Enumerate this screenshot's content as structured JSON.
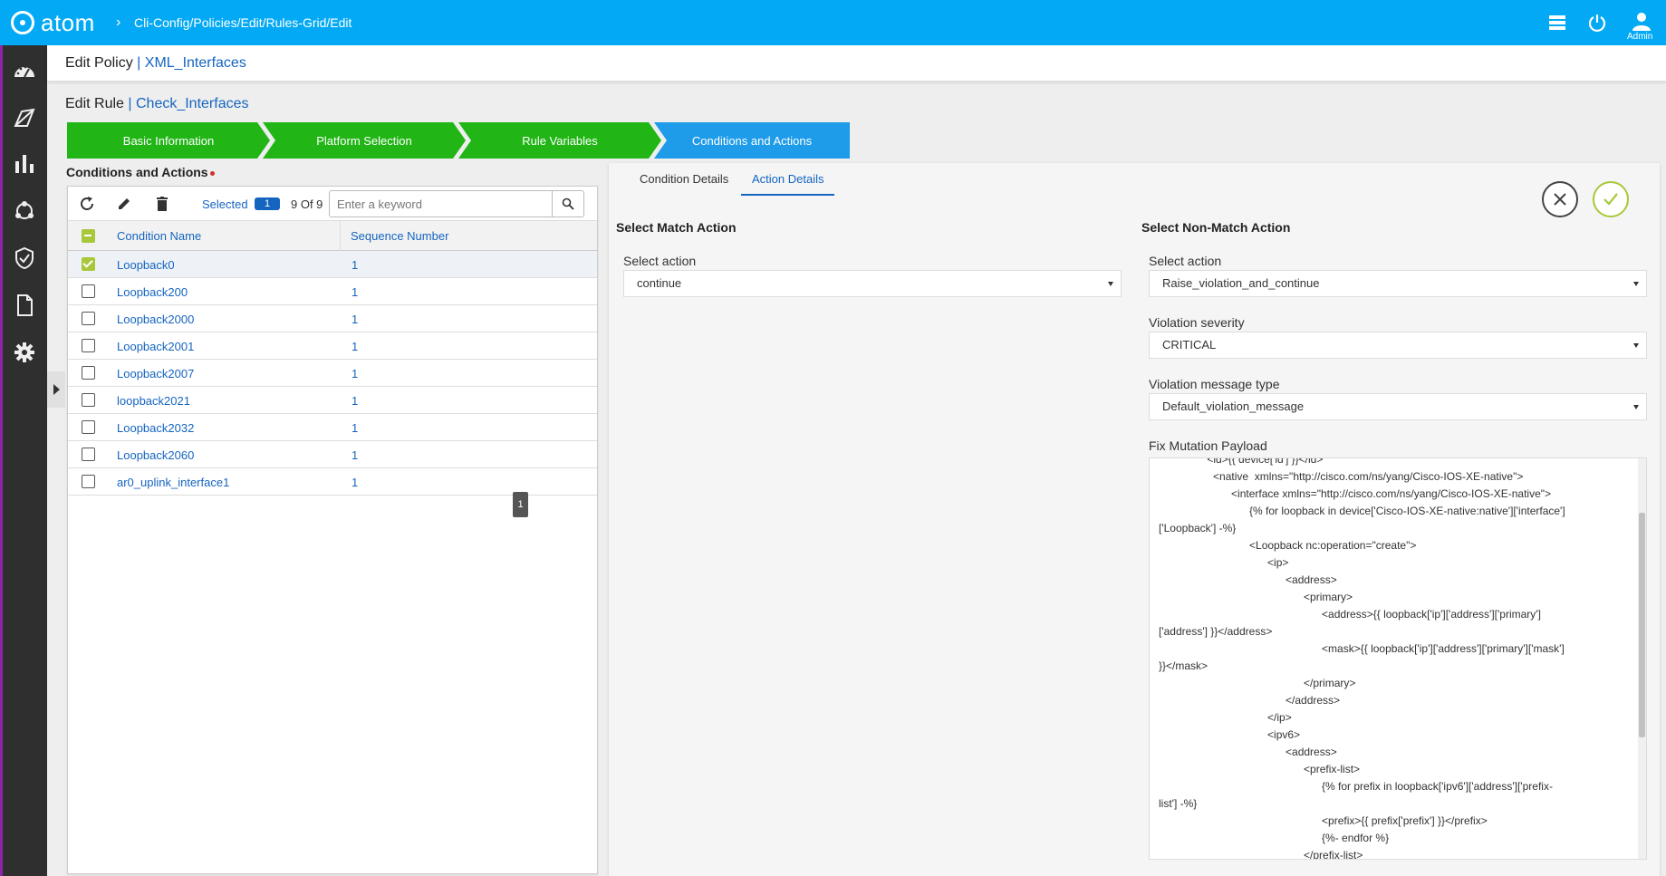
{
  "app": {
    "logo_text": "atom",
    "breadcrumb": "Cli-Config/Policies/Edit/Rules-Grid/Edit",
    "admin_label": "Admin"
  },
  "header": {
    "title_prefix": "Edit Policy",
    "title_sep": "|",
    "title_name": "XML_Interfaces"
  },
  "rule": {
    "title_prefix": "Edit Rule",
    "title_sep": "|",
    "title_name": "Check_Interfaces"
  },
  "wizard": {
    "steps": [
      {
        "label": "Basic Information",
        "state": "done"
      },
      {
        "label": "Platform Selection",
        "state": "done"
      },
      {
        "label": "Rule Variables",
        "state": "done"
      },
      {
        "label": "Conditions and Actions",
        "state": "active"
      }
    ]
  },
  "conditions": {
    "title": "Conditions and Actions",
    "selected_label": "Selected",
    "selected_count": "1",
    "count_text": "9 Of 9",
    "search_placeholder": "Enter a keyword",
    "columns": [
      "Condition Name",
      "Sequence Number"
    ],
    "rows": [
      {
        "name": "Loopback0",
        "seq": "1",
        "checked": true
      },
      {
        "name": "Loopback200",
        "seq": "1",
        "checked": false
      },
      {
        "name": "Loopback2000",
        "seq": "1",
        "checked": false
      },
      {
        "name": "Loopback2001",
        "seq": "1",
        "checked": false
      },
      {
        "name": "Loopback2007",
        "seq": "1",
        "checked": false
      },
      {
        "name": "loopback2021",
        "seq": "1",
        "checked": false
      },
      {
        "name": "Loopback2032",
        "seq": "1",
        "checked": false
      },
      {
        "name": "Loopback2060",
        "seq": "1",
        "checked": false
      },
      {
        "name": "ar0_uplink_interface1",
        "seq": "1",
        "checked": false
      }
    ],
    "page_number": "1"
  },
  "details": {
    "tabs": [
      "Condition Details",
      "Action Details"
    ],
    "active_tab": "Action Details",
    "match": {
      "title": "Select Match Action",
      "select_action_label": "Select action",
      "select_action_value": "continue"
    },
    "non_match": {
      "title": "Select Non-Match Action",
      "select_action_label": "Select action",
      "select_action_value": "Raise_violation_and_continue",
      "severity_label": "Violation severity",
      "severity_value": "CRITICAL",
      "message_type_label": "Violation message type",
      "message_type_value": "Default_violation_message",
      "payload_label": "Fix Mutation Payload",
      "payload_lines": [
        "                <id>{{ device['id'] }}</id>",
        "                  <native  xmlns=\"http://cisco.com/ns/yang/Cisco-IOS-XE-native\">",
        "                        <interface xmlns=\"http://cisco.com/ns/yang/Cisco-IOS-XE-native\">",
        "                              {% for loopback in device['Cisco-IOS-XE-native:native']['interface']",
        "['Loopback'] -%}",
        "                              <Loopback nc:operation=\"create\">",
        "                                    <ip>",
        "                                          <address>",
        "                                                <primary>",
        "                                                      <address>{{ loopback['ip']['address']['primary']",
        "['address'] }}</address>",
        "                                                      <mask>{{ loopback['ip']['address']['primary']['mask']",
        "}}</mask>",
        "                                                </primary>",
        "                                          </address>",
        "                                    </ip>",
        "                                    <ipv6>",
        "                                          <address>",
        "                                                <prefix-list>",
        "                                                      {% for prefix in loopback['ipv6']['address']['prefix-",
        "list'] -%}",
        "                                                      <prefix>{{ prefix['prefix'] }}</prefix>",
        "                                                      {%- endfor %}",
        "                                                </prefix-list>"
      ]
    }
  },
  "colors": {
    "topbar": "#03a9f4",
    "sidebar": "#2f2f2f",
    "step_done": "#21b516",
    "step_active": "#1e9be9",
    "link": "#1565c0",
    "check_green": "#a7c83a"
  }
}
